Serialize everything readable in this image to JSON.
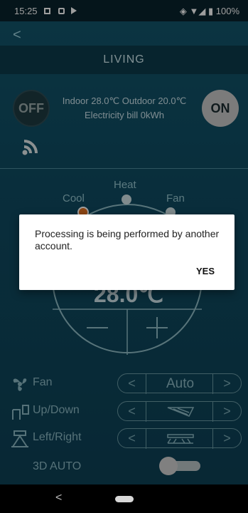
{
  "status_bar": {
    "time": "15:25",
    "battery": "100%"
  },
  "header": {
    "title": "LIVING"
  },
  "power": {
    "off_label": "OFF",
    "on_label": "ON"
  },
  "info": {
    "line1": "Indoor 28.0℃  Outdoor 20.0℃",
    "line2": "Electricity bill 0kWh"
  },
  "modes": {
    "heat": "Heat",
    "cool": "Cool",
    "fan": "Fan"
  },
  "temperature": {
    "display": "28.0℃",
    "minus": "—",
    "plus": "+"
  },
  "controls": {
    "fan": {
      "label": "Fan",
      "value": "Auto"
    },
    "updown": {
      "label": "Up/Down"
    },
    "leftright": {
      "label": "Left/Right"
    },
    "auto3d": {
      "label": "3D AUTO",
      "enabled": false
    }
  },
  "dialog": {
    "message": "Processing is being performed by another account.",
    "confirm_label": "YES"
  },
  "colors": {
    "accent_mode": "#e07020",
    "panel": "#12546a",
    "dialog_bg": "#ffffff"
  }
}
